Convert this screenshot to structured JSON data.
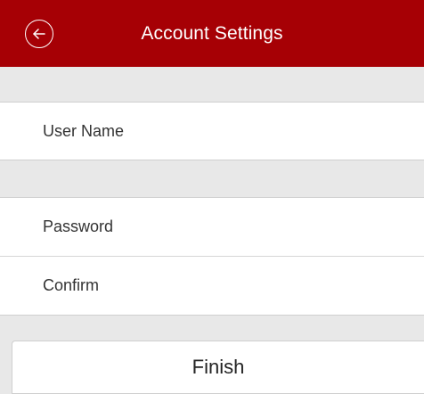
{
  "header": {
    "title": "Account Settings",
    "back_icon": "back-arrow-circle-icon",
    "background_color": "#a60005"
  },
  "form": {
    "user_name_placeholder": "User Name",
    "password_placeholder": "Password",
    "confirm_placeholder": "Confirm"
  },
  "actions": {
    "finish_label": "Finish"
  }
}
